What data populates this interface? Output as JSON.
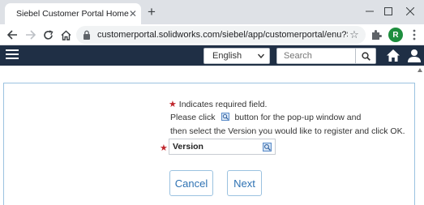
{
  "browser": {
    "tab_title": "Siebel Customer Portal Home",
    "url": "customerportal.solidworks.com/siebel/app/customerportal/enu?SWEC...",
    "profile_initial": "R"
  },
  "header": {
    "language": "English",
    "search_placeholder": "Search"
  },
  "form": {
    "required_marker": "★",
    "required_note": "Indicates required field.",
    "instruction_1a": "Please click",
    "instruction_1b": "button for the pop-up window and",
    "instruction_2": "then select the Version you would like to register and click OK.",
    "version_label": "Version"
  },
  "buttons": {
    "cancel": "Cancel",
    "next": "Next"
  },
  "colors": {
    "header_bg": "#1f2f45",
    "accent": "#2e72b3",
    "required": "#c0272d",
    "panel_border": "#9bc2e0"
  }
}
